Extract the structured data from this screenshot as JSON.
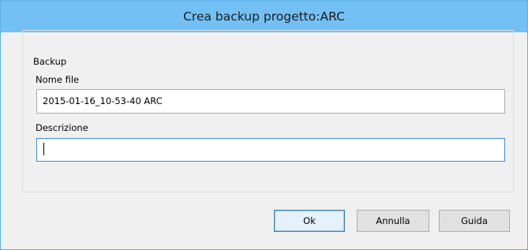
{
  "dialog": {
    "title": "Crea backup progetto:ARC"
  },
  "backup_group": {
    "legend": "Backup",
    "filename_label": "Nome file",
    "filename_value": "2015-01-16_10-53-40 ARC",
    "description_label": "Descrizione",
    "description_value": ""
  },
  "buttons": {
    "ok": "Ok",
    "cancel": "Annulla",
    "help": "Guida"
  },
  "colors": {
    "titlebar": "#73c0f4",
    "window_border": "#5eb1e8",
    "focus_border": "#3d8ee0",
    "default_button_border": "#3c7fb1"
  }
}
